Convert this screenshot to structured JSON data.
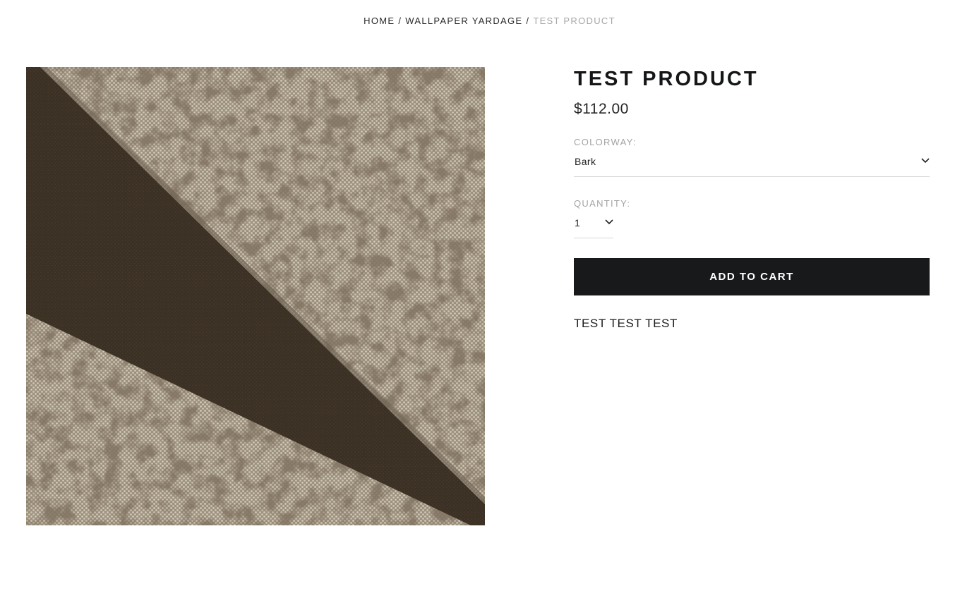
{
  "breadcrumb": {
    "home": "HOME",
    "separator": "/",
    "collection": "WALLPAPER YARDAGE",
    "current": "TEST PRODUCT"
  },
  "product": {
    "image_icon": "product-swatch-image",
    "title": "TEST PRODUCT",
    "price": "$112.00",
    "colorway": {
      "label": "COLORWAY:",
      "selected": "Bark"
    },
    "quantity": {
      "label": "QUANTITY:",
      "selected": "1"
    },
    "add_to_cart_label": "ADD TO CART",
    "description": "TEST TEST TEST"
  },
  "colors": {
    "button_bg": "#18191b",
    "stripe": "#3f3426",
    "texture_light": "#b8ad9c",
    "texture_dark": "#4a3e31",
    "muted_text": "#a6a6a6"
  },
  "icons": {
    "dropdown": "chevron-down-icon"
  }
}
